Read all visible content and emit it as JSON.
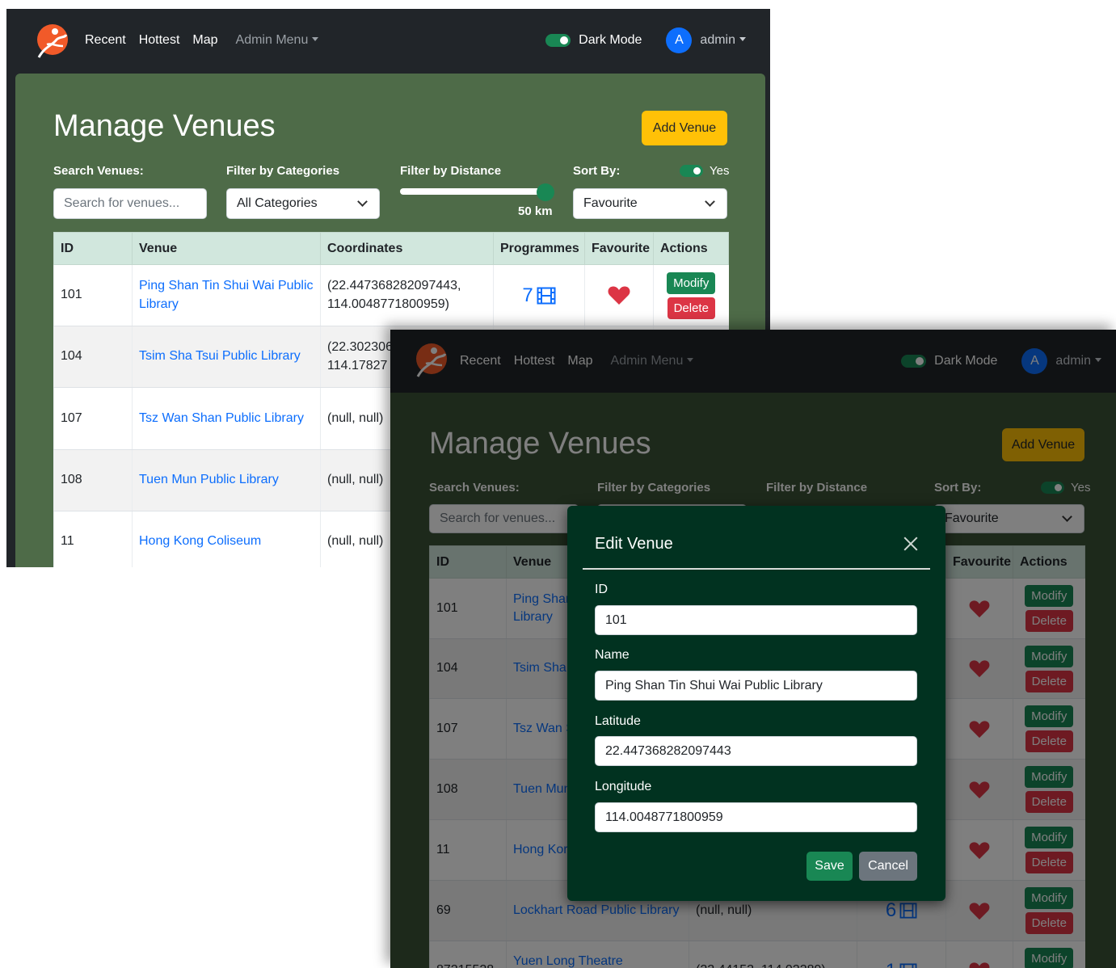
{
  "nav": {
    "links": [
      "Recent",
      "Hottest",
      "Map"
    ],
    "admin_menu": "Admin Menu",
    "dark_mode_label": "Dark Mode",
    "avatar_letter": "A",
    "username": "admin"
  },
  "page": {
    "title": "Manage Venues",
    "add_button": "Add Venue"
  },
  "filters": {
    "search_label": "Search Venues:",
    "search_placeholder": "Search for venues...",
    "category_label": "Filter by Categories",
    "category_value": "All Categories",
    "distance_label": "Filter by Distance",
    "distance_value": "50 km",
    "distance_fraction": 1.0,
    "sort_label": "Sort By:",
    "sort_toggle_label": "Yes",
    "sort_value": "Favourite"
  },
  "table": {
    "headers": [
      "ID",
      "Venue",
      "Coordinates",
      "Programmes",
      "Favourite",
      "Actions"
    ],
    "modify_label": "Modify",
    "delete_label": "Delete"
  },
  "rows_front": [
    {
      "id": "101",
      "venue": "Ping Shan Tin Shui Wai Public Library",
      "coords": "(22.447368282097443, 114.0048771800959)",
      "programmes": "7"
    },
    {
      "id": "104",
      "venue": "Tsim Sha Tsui Public Library",
      "coords": "(22.302306",
      "coords2": "114.17827"
    },
    {
      "id": "107",
      "venue": "Tsz Wan Shan Public Library",
      "coords": "(null, null)"
    },
    {
      "id": "108",
      "venue": "Tuen Mun Public Library",
      "coords": "(null, null)"
    },
    {
      "id": "11",
      "venue": "Hong Kong Coliseum",
      "coords": "(null, null)"
    }
  ],
  "rows_back": [
    {
      "id": "101",
      "venue": "Ping Shan",
      "venue2": "Library"
    },
    {
      "id": "104",
      "venue": "Tsim Sha T"
    },
    {
      "id": "107",
      "venue": "Tsz Wan S"
    },
    {
      "id": "108",
      "venue": "Tuen Mun"
    },
    {
      "id": "11",
      "venue": "Hong Kor"
    },
    {
      "id": "69",
      "venue": "Lockhart Road Public Library",
      "coords": "(null, null)",
      "programmes": "6"
    },
    {
      "id": "87215528",
      "venue": "Yuen Long Theatre (Exhibition",
      "coords": "(22.44152, 114.02289)",
      "programmes": "1"
    }
  ],
  "modal": {
    "title": "Edit Venue",
    "id_label": "ID",
    "id_value": "101",
    "name_label": "Name",
    "name_value": "Ping Shan Tin Shui Wai Public Library",
    "lat_label": "Latitude",
    "lat_value": "22.447368282097443",
    "lng_label": "Longitude",
    "lng_value": "114.0048771800959",
    "save_label": "Save",
    "cancel_label": "Cancel"
  },
  "colors": {
    "navbar": "#212529",
    "content_green": "#4e6b48",
    "modal_bg": "#013220",
    "accent_yellow": "#ffc107",
    "success": "#198754",
    "danger": "#dc3545",
    "link": "#0d6efd",
    "header_row": "#d1e7dd"
  },
  "icons": {
    "logo": "runner-logo-icon",
    "programmes": "film-icon",
    "favourite": "heart-icon",
    "close": "close-icon"
  }
}
